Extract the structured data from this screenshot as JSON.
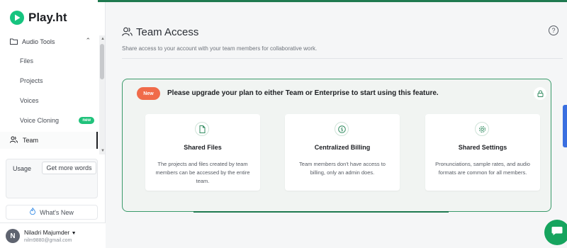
{
  "sidebar": {
    "brand": "Play.ht",
    "section_label": "Audio Tools",
    "items": [
      {
        "label": "Files"
      },
      {
        "label": "Projects"
      },
      {
        "label": "Voices"
      },
      {
        "label": "Voice Cloning",
        "badge": "new"
      }
    ],
    "team_label": "Team",
    "usage_label": "Usage",
    "get_more_words": "Get more words",
    "whats_new": "What's New",
    "user_name": "Niladri Majumder",
    "user_email": "nilm9880@gmail.com",
    "user_initial": "N"
  },
  "main": {
    "title": "Team Access",
    "subtitle": "Share access to your account with your team members for collaborative work.",
    "help": "?",
    "upgrade": {
      "pill": "New",
      "message": "Please upgrade your plan to either Team or Enterprise to start using this feature."
    },
    "features": [
      {
        "title": "Shared Files",
        "desc": "The projects and files created by team members can be accessed by the entire team.",
        "icon": "file-icon"
      },
      {
        "title": "Centralized Billing",
        "desc": "Team members don't have access to billing, only an admin does.",
        "icon": "dollar-icon"
      },
      {
        "title": "Shared Settings",
        "desc": "Pronunciations, sample rates, and audio formats are common for all members.",
        "icon": "gear-icon"
      }
    ]
  },
  "colors": {
    "brand": "#16c47f",
    "accent": "#1f7a50",
    "pill": "#f06b4a"
  }
}
